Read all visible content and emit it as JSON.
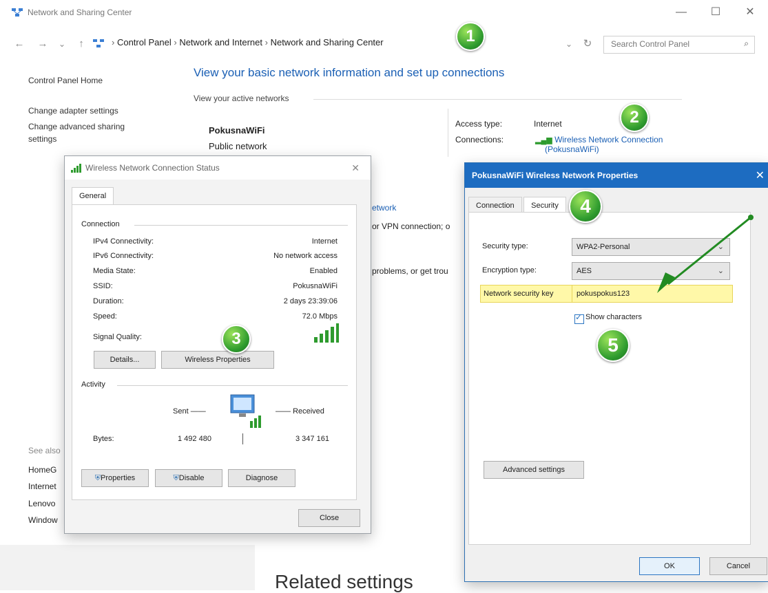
{
  "main": {
    "window_title": "Network and Sharing Center",
    "breadcrumb": [
      "Control Panel",
      "Network and Internet",
      "Network and Sharing Center"
    ],
    "search_placeholder": "Search Control Panel",
    "headline": "View your basic network information and set up connections",
    "active_networks_label": "View your active networks",
    "network_name": "PokusnaWiFi",
    "network_type": "Public network",
    "access_type_label": "Access type:",
    "access_type_value": "Internet",
    "connections_label": "Connections:",
    "connection_link_line1": "Wireless Network Connection",
    "connection_link_line2": "(PokusnaWiFi)",
    "left_links": {
      "home": "Control Panel Home",
      "adapter": "Change adapter settings",
      "advanced": "Change advanced sharing",
      "advanced2": "settings"
    },
    "see_also": [
      "See also",
      "HomeG",
      "Internet",
      "Lenovo",
      "Window"
    ],
    "partial_texts": [
      "etwork",
      "or VPN connection; o",
      "problems, or get trou"
    ],
    "related_settings": "Related settings"
  },
  "status_dialog": {
    "title": "Wireless Network Connection Status",
    "tab": "General",
    "section_connection": "Connection",
    "rows": [
      {
        "label": "IPv4 Connectivity:",
        "value": "Internet"
      },
      {
        "label": "IPv6 Connectivity:",
        "value": "No network access"
      },
      {
        "label": "Media State:",
        "value": "Enabled"
      },
      {
        "label": "SSID:",
        "value": "PokusnaWiFi"
      },
      {
        "label": "Duration:",
        "value": "2 days 23:39:06"
      },
      {
        "label": "Speed:",
        "value": "72.0 Mbps"
      }
    ],
    "signal_quality_label": "Signal Quality:",
    "details_button": "Details...",
    "wireless_properties_button": "Wireless Properties",
    "section_activity": "Activity",
    "sent_label": "Sent",
    "received_label": "Received",
    "bytes_label": "Bytes:",
    "bytes_sent": "1 492 480",
    "bytes_received": "3 347 161",
    "properties_button": "Properties",
    "disable_button": "Disable",
    "diagnose_button": "Diagnose",
    "close_button": "Close"
  },
  "prop_dialog": {
    "title": "PokusnaWiFi Wireless Network Properties",
    "tab_connection": "Connection",
    "tab_security": "Security",
    "security_type_label": "Security type:",
    "security_type_value": "WPA2-Personal",
    "encryption_type_label": "Encryption type:",
    "encryption_type_value": "AES",
    "key_label": "Network security key",
    "key_value": "pokuspokus123",
    "show_characters": "Show characters",
    "advanced_button": "Advanced settings",
    "ok_button": "OK",
    "cancel_button": "Cancel"
  },
  "badges": [
    "1",
    "2",
    "3",
    "4",
    "5"
  ],
  "colors": {
    "link": "#1a5fb4",
    "titlebar": "#1d6cc1",
    "highlight": "#fff8a8",
    "badge": "#2e9b2e",
    "arrow": "#228b22"
  }
}
